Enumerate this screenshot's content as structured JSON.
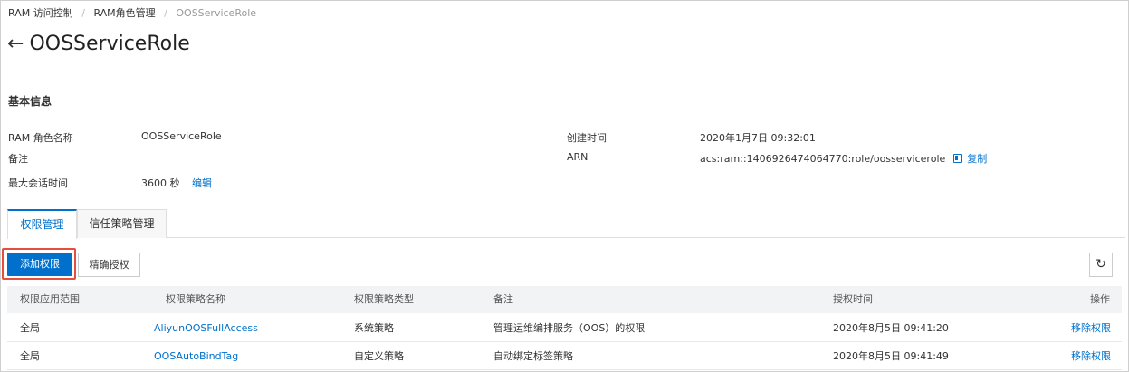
{
  "breadcrumb": {
    "items": [
      "RAM 访问控制",
      "RAM角色管理"
    ],
    "current": "OOSServiceRole",
    "separator": "/"
  },
  "header": {
    "title": "OOSServiceRole",
    "back_icon": "arrow-left-icon"
  },
  "basic_info": {
    "section_title": "基本信息",
    "role_name_label": "RAM 角色名称",
    "role_name_value": "OOSServiceRole",
    "note_label": "备注",
    "note_value": "",
    "max_session_label": "最大会话时间",
    "max_session_value": "3600 秒",
    "edit_link": "编辑",
    "created_label": "创建时间",
    "created_value": "2020年1月7日 09:32:01",
    "arn_label": "ARN",
    "arn_value": "acs:ram::1406926474064770:role/oosservicerole",
    "copy_link": "复制"
  },
  "tabs": [
    {
      "label": "权限管理",
      "active": true
    },
    {
      "label": "信任策略管理",
      "active": false
    }
  ],
  "toolbar": {
    "add_permission_label": "添加权限",
    "precise_auth_label": "精确授权",
    "refresh_icon": "refresh-icon"
  },
  "table": {
    "columns": [
      "权限应用范围",
      "权限策略名称",
      "权限策略类型",
      "备注",
      "授权时间",
      "操作"
    ],
    "rows": [
      {
        "scope": "全局",
        "policy_name": "AliyunOOSFullAccess",
        "policy_type": "系统策略",
        "note": "管理运维编排服务（OOS）的权限",
        "granted_at": "2020年8月5日 09:41:20",
        "action": "移除权限"
      },
      {
        "scope": "全局",
        "policy_name": "OOSAutoBindTag",
        "policy_type": "自定义策略",
        "note": "自动绑定标签策略",
        "granted_at": "2020年8月5日 09:41:49",
        "action": "移除权限"
      }
    ]
  },
  "colors": {
    "primary": "#0070cc",
    "highlight_border": "#e34e3d",
    "table_header_bg": "#f2f3f5"
  }
}
